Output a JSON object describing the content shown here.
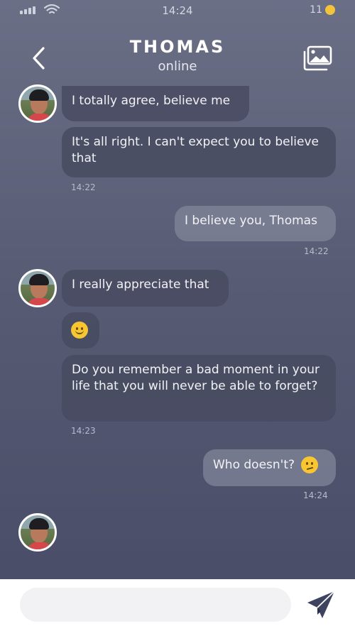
{
  "status_bar": {
    "time": "14:24",
    "battery": "11"
  },
  "header": {
    "title": "THOMAS",
    "subtitle": "online"
  },
  "messages": [
    {
      "side": "in",
      "text": "I totally agree, believe me"
    },
    {
      "side": "in",
      "text": "It's all right. I can't expect you to believe that",
      "time": "14:22"
    },
    {
      "side": "out",
      "text": "I believe you, Thomas",
      "time": "14:22"
    },
    {
      "side": "in",
      "text": "I really appreciate that"
    },
    {
      "side": "in",
      "emoji": "slightly-smiling-face-emoji"
    },
    {
      "side": "in",
      "text": "Do you remember a bad moment in your life that you will never be able to forget?",
      "time": "14:23"
    },
    {
      "side": "out",
      "text": "Who doesn't?",
      "emoji": "confused-face-emoji",
      "time": "14:24"
    }
  ],
  "composer": {
    "placeholder": ""
  },
  "icons": {
    "back": "chevron-left-icon",
    "gallery": "gallery-icon",
    "send": "send-icon"
  },
  "colors": {
    "background_top": "#6b6f86",
    "background_bottom": "#474b66",
    "incoming_bubble": "#484b60",
    "outgoing_bubble": "#828599"
  }
}
